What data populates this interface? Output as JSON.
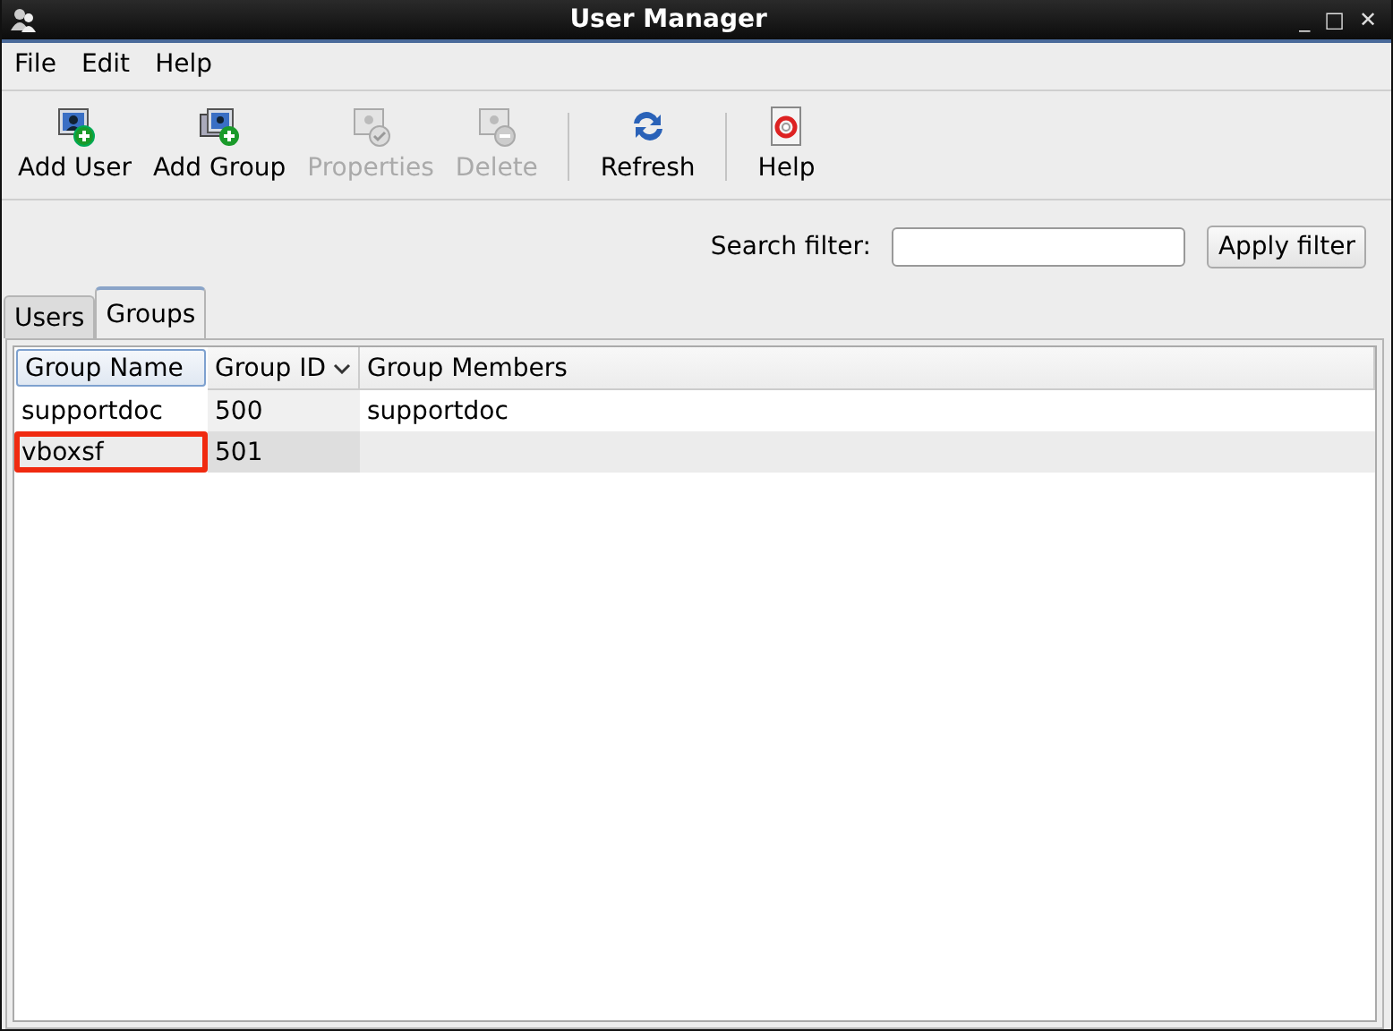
{
  "window": {
    "title": "User Manager",
    "controls": [
      "_",
      "□",
      "✕"
    ]
  },
  "menu": [
    "File",
    "Edit",
    "Help"
  ],
  "toolbar": [
    {
      "label": "Add User",
      "disabled": false,
      "separator_before": false
    },
    {
      "label": "Add Group",
      "disabled": false,
      "separator_before": false
    },
    {
      "label": "Properties",
      "disabled": true,
      "separator_before": false
    },
    {
      "label": "Delete",
      "disabled": true,
      "separator_before": false
    },
    {
      "label": "Refresh",
      "disabled": false,
      "separator_before": true
    },
    {
      "label": "Help",
      "disabled": false,
      "separator_before": true
    }
  ],
  "filter": {
    "label": "Search filter:",
    "button": "Apply filter"
  },
  "tabs": [
    {
      "label": "Users",
      "selected": false
    },
    {
      "label": "Groups",
      "selected": true
    }
  ],
  "table": {
    "columns": [
      {
        "label": "Group Name",
        "sorted": false
      },
      {
        "label": "Group ID",
        "sorted": true
      },
      {
        "label": "Group Members",
        "sorted": false
      }
    ],
    "rows": [
      {
        "cells": [
          "supportdoc",
          "500",
          "supportdoc"
        ],
        "annotated": false
      },
      {
        "cells": [
          "vboxsf",
          "501",
          ""
        ],
        "annotated": true
      }
    ]
  }
}
